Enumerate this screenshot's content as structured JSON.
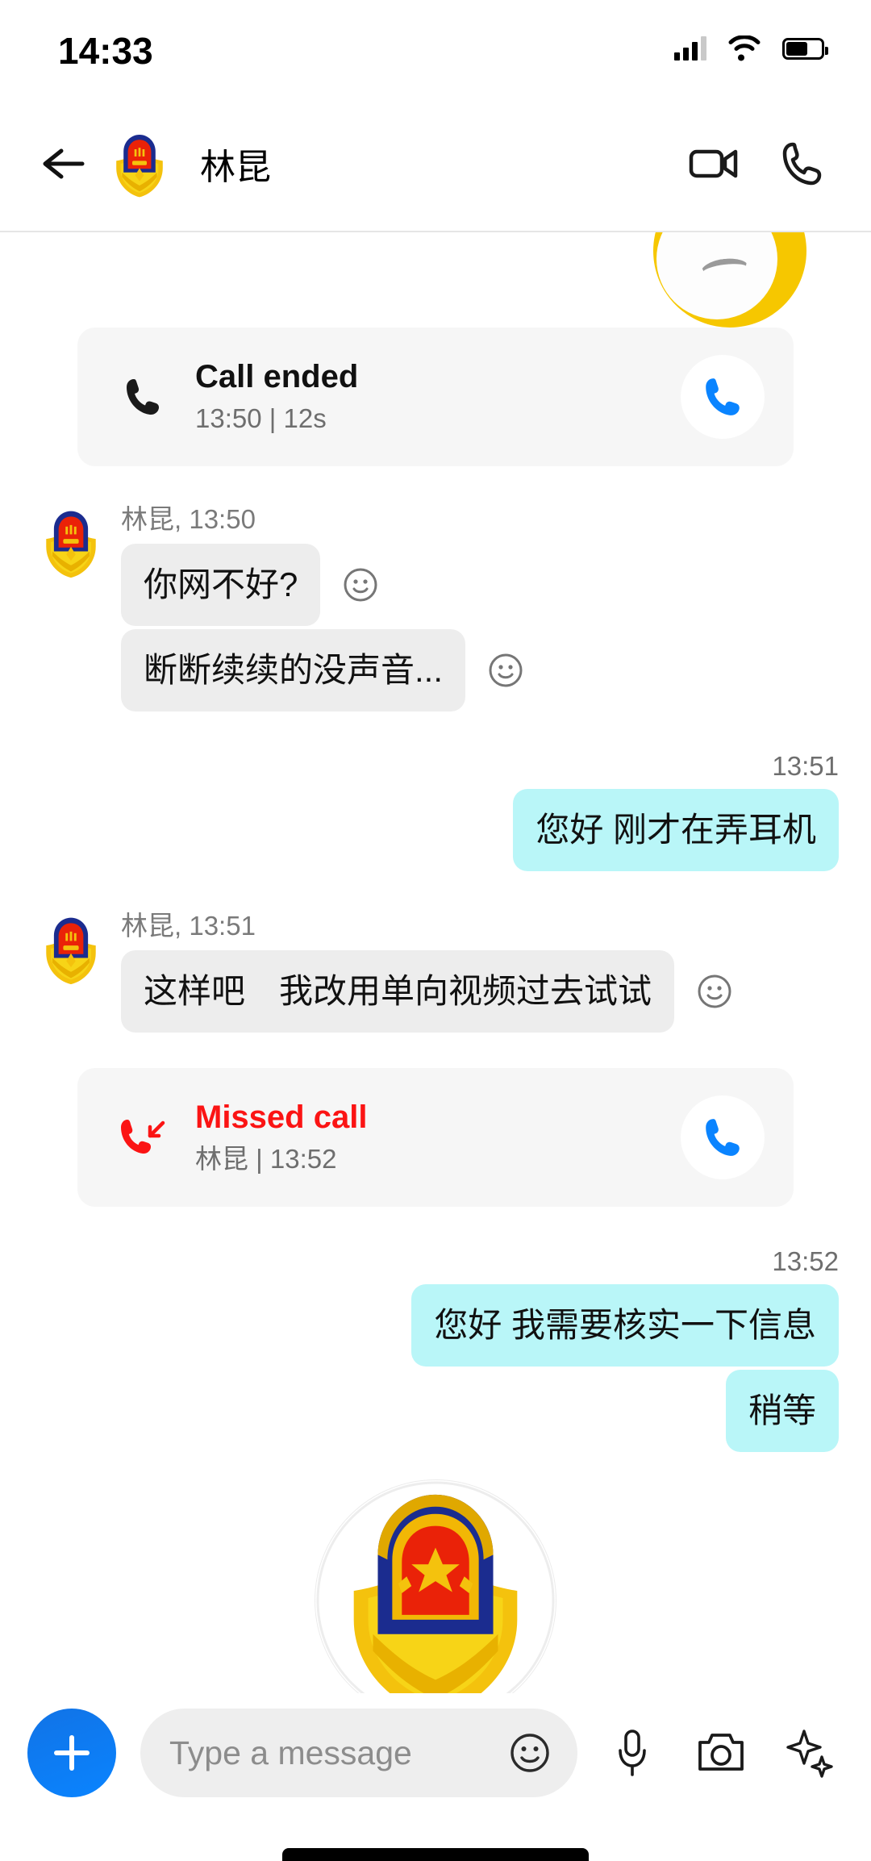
{
  "status_bar": {
    "time": "14:33",
    "icons": [
      "signal-icon",
      "wifi-icon",
      "battery-icon"
    ]
  },
  "header": {
    "back_icon": "back-arrow-icon",
    "avatar": "police-emblem-avatar",
    "title": "林昆",
    "video_call_icon": "video-camera-icon",
    "voice_call_icon": "phone-icon"
  },
  "conversation": {
    "call_ended_card": {
      "icon": "phone-icon",
      "title": "Call ended",
      "subtitle": "13:50 | 12s",
      "action_icon": "phone-callback-icon"
    },
    "missed_call_card": {
      "icon": "missed-call-icon",
      "title": "Missed call",
      "subtitle": "林昆 | 13:52",
      "action_icon": "phone-callback-icon"
    },
    "group_1": {
      "sender_line": "林昆, 13:50",
      "messages": [
        {
          "text": "你网不好?",
          "reaction_icon": "smiley-reaction-icon"
        },
        {
          "text": "断断续续的没声音...",
          "reaction_icon": "smiley-reaction-icon"
        }
      ]
    },
    "group_2": {
      "time": "13:51",
      "messages": [
        {
          "text": "您好 刚才在弄耳机"
        }
      ]
    },
    "group_3": {
      "sender_line": "林昆, 13:51",
      "messages": [
        {
          "text": "这样吧　我改用单向视频过去试试",
          "reaction_icon": "smiley-reaction-icon"
        }
      ]
    },
    "group_4": {
      "time": "13:52",
      "messages": [
        {
          "text": "您好 我需要核实一下信息"
        },
        {
          "text": "稍等"
        }
      ]
    }
  },
  "input_bar": {
    "add_label": "+",
    "placeholder": "Type a message",
    "value": "",
    "emoji_icon": "smiley-icon",
    "mic_icon": "microphone-icon",
    "camera_icon": "camera-icon",
    "sparkle_icon": "sparkle-ai-icon"
  },
  "colors": {
    "outgoing_bubble": "#b9f6f8",
    "incoming_bubble": "#ededed",
    "card_bg": "#f6f6f6",
    "missed_red": "#fb1414",
    "accent_blue": "#0a84ff",
    "muted_text": "#6e6e6e"
  }
}
